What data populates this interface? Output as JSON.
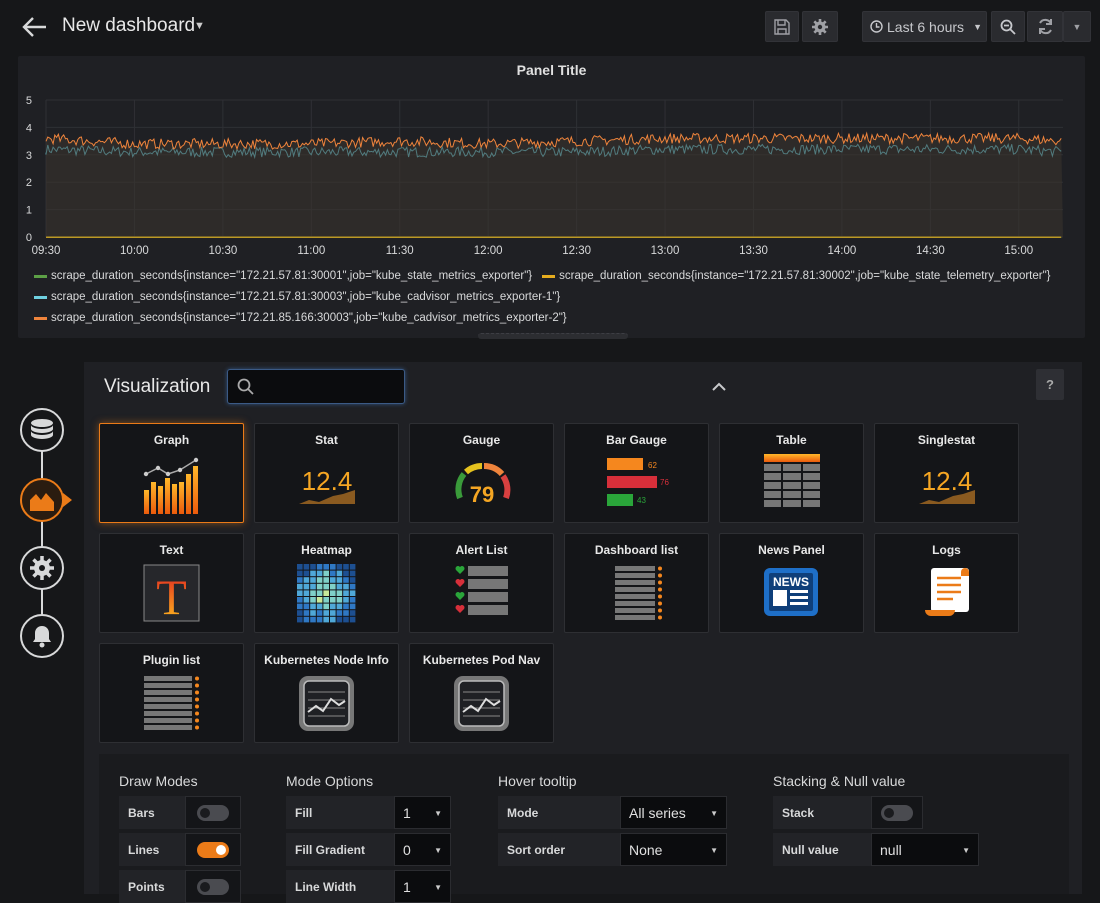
{
  "header": {
    "title": "New dashboard",
    "time_range": "Last 6 hours"
  },
  "panel": {
    "title": "Panel Title",
    "legend": [
      {
        "label": "scrape_duration_seconds{instance=\"172.21.57.81:30001\",job=\"kube_state_metrics_exporter\"}",
        "color": "#5ca046"
      },
      {
        "label": "scrape_duration_seconds{instance=\"172.21.57.81:30002\",job=\"kube_state_telemetry_exporter\"}",
        "color": "#e5ac1e"
      },
      {
        "label": "scrape_duration_seconds{instance=\"172.21.57.81:30003\",job=\"kube_cadvisor_metrics_exporter-1\"}",
        "color": "#6ed0e0"
      },
      {
        "label": "scrape_duration_seconds{instance=\"172.21.85.166:30003\",job=\"kube_cadvisor_metrics_exporter-2\"}",
        "color": "#ef843c"
      }
    ]
  },
  "chart_data": {
    "type": "line",
    "title": "Panel Title",
    "x_ticks": [
      "09:30",
      "10:00",
      "10:30",
      "11:00",
      "11:30",
      "12:00",
      "12:30",
      "13:00",
      "13:30",
      "14:00",
      "14:30",
      "15:00"
    ],
    "x_range": [
      "09:30",
      "15:15"
    ],
    "ylim": [
      0,
      5
    ],
    "y_ticks": [
      "0",
      "1",
      "2",
      "3",
      "4",
      "5"
    ],
    "grid": true,
    "legend_position": "bottom",
    "series": [
      {
        "name": "scrape_duration_seconds{instance=\"172.21.57.81:30001\",job=\"kube_state_metrics_exporter\"}",
        "color": "#5ca046",
        "x": [
          "09:30",
          "15:15"
        ],
        "values": [
          0.0,
          0.0
        ]
      },
      {
        "name": "scrape_duration_seconds{instance=\"172.21.57.81:30002\",job=\"kube_state_telemetry_exporter\"}",
        "color": "#e5ac1e",
        "x": [
          "09:30",
          "15:15"
        ],
        "values": [
          0.0,
          0.0
        ]
      },
      {
        "name": "scrape_duration_seconds{instance=\"172.21.57.81:30003\",job=\"kube_cadvisor_metrics_exporter-1\"}",
        "color": "#6ed0e0",
        "x": [
          "09:30",
          "10:00",
          "10:30",
          "11:00",
          "11:30",
          "12:00",
          "12:30",
          "13:00",
          "13:30",
          "14:00",
          "14:30",
          "15:00",
          "15:15"
        ],
        "values": [
          3.2,
          3.1,
          3.1,
          3.1,
          3.1,
          3.1,
          3.1,
          3.2,
          3.2,
          3.2,
          3.2,
          3.2,
          3.1
        ]
      },
      {
        "name": "scrape_duration_seconds{instance=\"172.21.85.166:30003\",job=\"kube_cadvisor_metrics_exporter-2\"}",
        "color": "#ef843c",
        "x": [
          "09:30",
          "10:00",
          "10:30",
          "11:00",
          "11:30",
          "12:00",
          "12:30",
          "13:00",
          "13:30",
          "14:00",
          "14:30",
          "15:00",
          "15:15"
        ],
        "values": [
          3.6,
          3.4,
          3.4,
          3.4,
          3.5,
          3.4,
          3.5,
          3.6,
          3.6,
          3.6,
          3.6,
          3.6,
          3.5
        ]
      }
    ]
  },
  "viz": {
    "title": "Visualization",
    "search_placeholder": "",
    "help": "?",
    "cards": [
      {
        "label": "Graph",
        "icon": "graph-icon"
      },
      {
        "label": "Stat",
        "icon": "stat-icon",
        "value": "12.4"
      },
      {
        "label": "Gauge",
        "icon": "gauge-icon",
        "value": "79"
      },
      {
        "label": "Bar Gauge",
        "icon": "bar-gauge-icon",
        "values": [
          "62",
          "76",
          "43"
        ]
      },
      {
        "label": "Table",
        "icon": "table-icon"
      },
      {
        "label": "Singlestat",
        "icon": "singlestat-icon",
        "value": "12.4"
      },
      {
        "label": "Text",
        "icon": "text-icon",
        "glyph": "T"
      },
      {
        "label": "Heatmap",
        "icon": "heatmap-icon"
      },
      {
        "label": "Alert List",
        "icon": "alert-list-icon"
      },
      {
        "label": "Dashboard list",
        "icon": "dashboard-list-icon"
      },
      {
        "label": "News Panel",
        "icon": "news-icon",
        "glyph": "NEWS"
      },
      {
        "label": "Logs",
        "icon": "logs-icon"
      },
      {
        "label": "Plugin list",
        "icon": "plugin-list-icon"
      },
      {
        "label": "Kubernetes Node Info",
        "icon": "kubernetes-node-icon"
      },
      {
        "label": "Kubernetes Pod Nav",
        "icon": "kubernetes-pod-icon"
      }
    ]
  },
  "options": {
    "draw_modes": {
      "title": "Draw Modes",
      "bars": "Bars",
      "lines": "Lines",
      "points": "Points",
      "bars_on": false,
      "lines_on": true,
      "points_on": false
    },
    "mode_options": {
      "title": "Mode Options",
      "fill_label": "Fill",
      "fill_value": "1",
      "gradient_label": "Fill Gradient",
      "gradient_value": "0",
      "width_label": "Line Width",
      "width_value": "1"
    },
    "hover": {
      "title": "Hover tooltip",
      "mode_label": "Mode",
      "mode_value": "All series",
      "sort_label": "Sort order",
      "sort_value": "None"
    },
    "stacking": {
      "title": "Stacking & Null value",
      "stack_label": "Stack",
      "stack_on": false,
      "null_label": "Null value",
      "null_value": "null"
    }
  }
}
